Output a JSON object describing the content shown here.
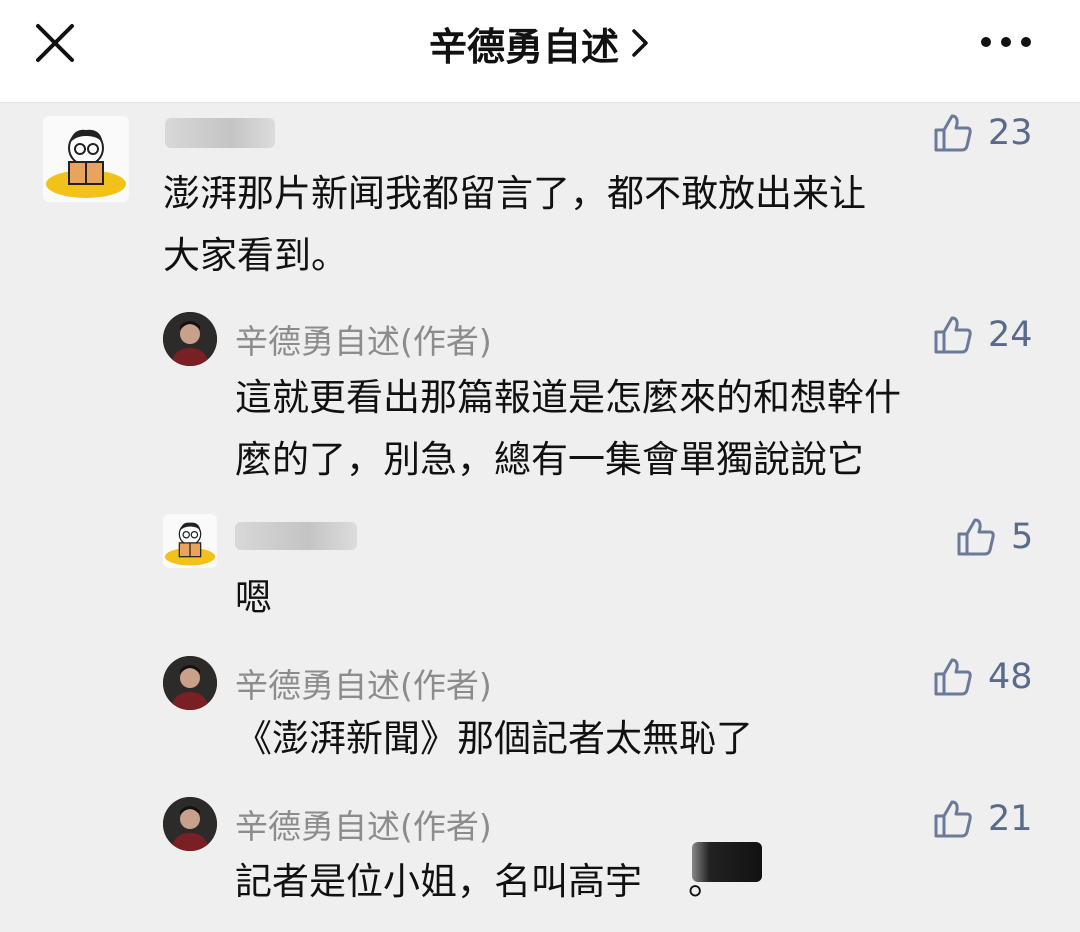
{
  "header": {
    "title": "辛德勇自述",
    "chevron": ">",
    "close_icon": "close-icon",
    "more_icon": "more-horizontal-icon"
  },
  "colors": {
    "background": "#efefef",
    "header_bg": "#ffffff",
    "like_icon": "#6b7a99",
    "name_text": "#8c8c8c",
    "yellow_avatar": "#f2c21a"
  },
  "comments": [
    {
      "author": "",
      "author_redacted": true,
      "text_line1": "澎湃那片新闻我都留言了，都不敢放出来让",
      "text_line2": "大家看到。",
      "likes": "23"
    },
    {
      "author": "辛德勇自述(作者)",
      "text_line1": "這就更看出那篇報道是怎麼來的和想幹什",
      "text_line2": "麼的了，別急，總有一集會單獨說說它",
      "likes": "24"
    },
    {
      "author": "",
      "author_redacted": true,
      "text_line1": "嗯",
      "likes": "5"
    },
    {
      "author": "辛德勇自述(作者)",
      "text_line1": "《澎湃新聞》那個記者太無恥了",
      "likes": "48"
    },
    {
      "author": "辛德勇自述(作者)",
      "text_line1": "記者是位小姐，名叫高宇",
      "text_tail": "。",
      "likes": "21"
    }
  ]
}
